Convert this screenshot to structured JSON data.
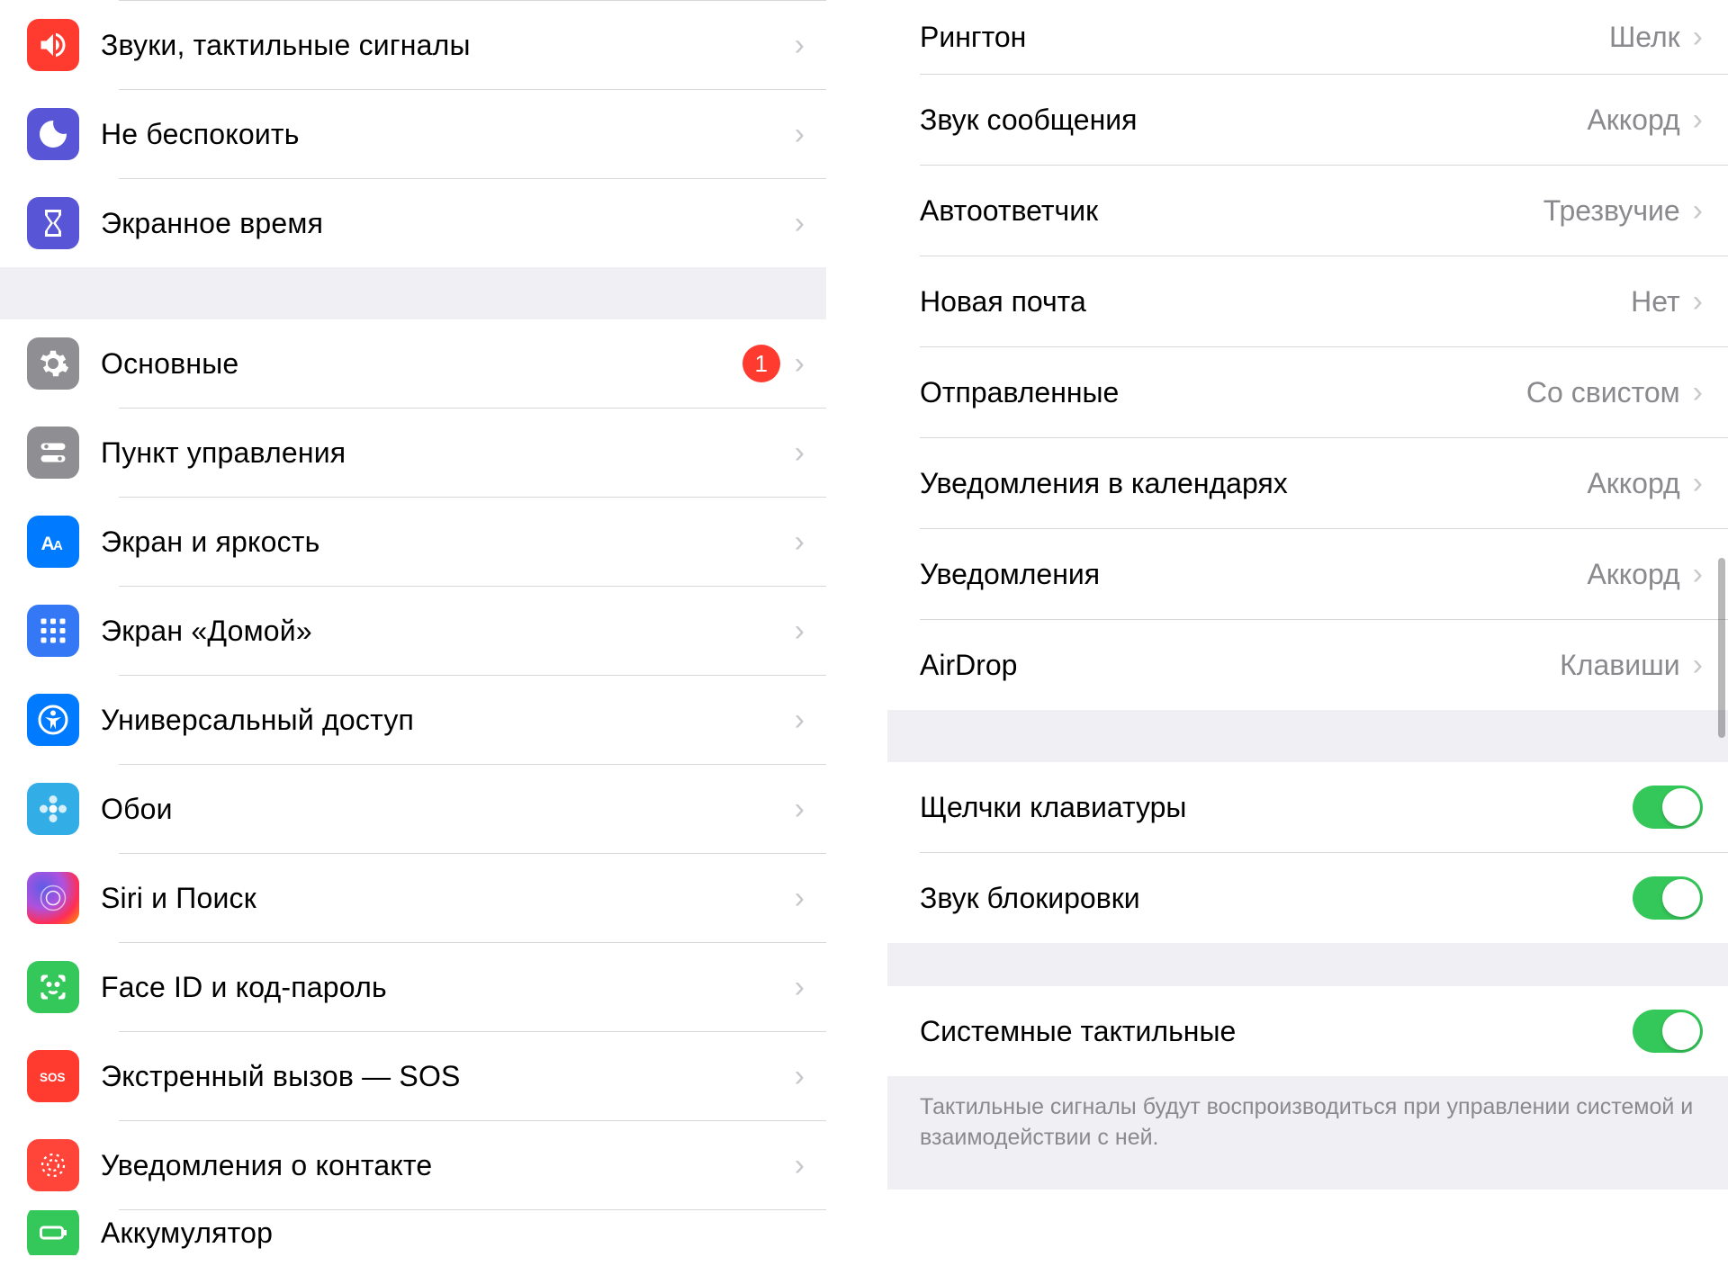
{
  "sidebar": {
    "group1": [
      {
        "label": "Звуки, тактильные сигналы",
        "icon": "speaker",
        "color": "red"
      },
      {
        "label": "Не беспокоить",
        "icon": "moon",
        "color": "purple"
      },
      {
        "label": "Экранное время",
        "icon": "hourglass",
        "color": "purple"
      }
    ],
    "group2": [
      {
        "label": "Основные",
        "icon": "gear",
        "color": "gray",
        "badge": "1"
      },
      {
        "label": "Пункт управления",
        "icon": "switches",
        "color": "gray"
      },
      {
        "label": "Экран и яркость",
        "icon": "aa",
        "color": "blue"
      },
      {
        "label": "Экран «Домой»",
        "icon": "grid",
        "color": "bluegrid"
      },
      {
        "label": "Универсальный доступ",
        "icon": "accessibility",
        "color": "blue"
      },
      {
        "label": "Обои",
        "icon": "flower",
        "color": "cyan"
      },
      {
        "label": "Siri и Поиск",
        "icon": "siri",
        "color": "siri"
      },
      {
        "label": "Face ID и код-пароль",
        "icon": "faceid",
        "color": "green"
      },
      {
        "label": "Экстренный вызов — SOS",
        "icon": "sos",
        "color": "red2"
      },
      {
        "label": "Уведомления о контакте",
        "icon": "sun",
        "color": "coral"
      },
      {
        "label": "Аккумулятор",
        "icon": "battery",
        "color": "green"
      }
    ]
  },
  "detail": {
    "sounds": [
      {
        "label": "Рингтон",
        "value": "Шелк"
      },
      {
        "label": "Звук сообщения",
        "value": "Аккорд"
      },
      {
        "label": "Автоответчик",
        "value": "Трезвучие"
      },
      {
        "label": "Новая почта",
        "value": "Нет"
      },
      {
        "label": "Отправленные",
        "value": "Со свистом"
      },
      {
        "label": "Уведомления в календарях",
        "value": "Аккорд"
      },
      {
        "label": "Уведомления",
        "value": "Аккорд"
      },
      {
        "label": "AirDrop",
        "value": "Клавиши"
      }
    ],
    "toggles1": [
      {
        "label": "Щелчки клавиатуры",
        "on": true
      },
      {
        "label": "Звук блокировки",
        "on": true
      }
    ],
    "toggles2": [
      {
        "label": "Системные тактильные",
        "on": true
      }
    ],
    "footer": "Тактильные сигналы будут воспроизводиться при управлении системой и взаимодействии с ней."
  }
}
